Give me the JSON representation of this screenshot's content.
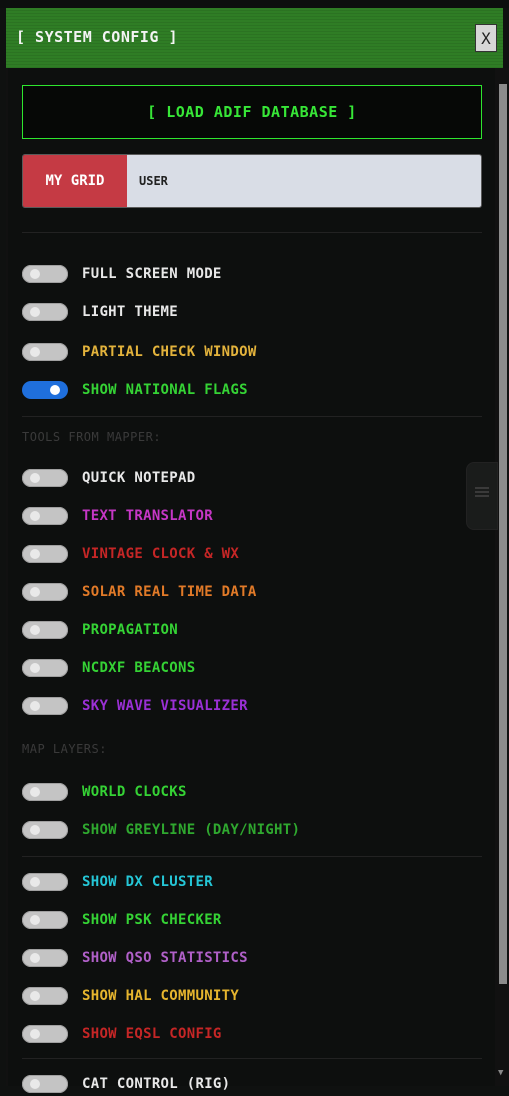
{
  "header": {
    "title": "[ SYSTEM CONFIG ]",
    "close_label": "X"
  },
  "load_button": {
    "label": "[ LOAD ADIF DATABASE ]"
  },
  "grid": {
    "label": "MY GRID",
    "value": "USER"
  },
  "sections": {
    "tools": "TOOLS FROM MAPPER:",
    "map_layers": "MAP LAYERS:"
  },
  "toggles": [
    {
      "label": "FULL SCREEN MODE",
      "on": false,
      "color": "#e8e8e8"
    },
    {
      "label": "LIGHT THEME",
      "on": false,
      "color": "#e8e8e8"
    },
    {
      "label": "PARTIAL CHECK WINDOW",
      "on": false,
      "color": "#e3b33c"
    },
    {
      "label": "SHOW NATIONAL FLAGS",
      "on": true,
      "color": "#35d335"
    },
    {
      "label": "QUICK NOTEPAD",
      "on": false,
      "color": "#e8e8e8"
    },
    {
      "label": "TEXT TRANSLATOR",
      "on": false,
      "color": "#c637c6"
    },
    {
      "label": "VINTAGE CLOCK & WX",
      "on": false,
      "color": "#c52626"
    },
    {
      "label": "SOLAR REAL TIME DATA",
      "on": false,
      "color": "#e17a28"
    },
    {
      "label": "PROPAGATION",
      "on": false,
      "color": "#35d335"
    },
    {
      "label": "NCDXF BEACONS",
      "on": false,
      "color": "#35d335"
    },
    {
      "label": "SKY WAVE VISUALIZER",
      "on": false,
      "color": "#9b30d6"
    },
    {
      "label": "WORLD CLOCKS",
      "on": false,
      "color": "#35d335"
    },
    {
      "label": "SHOW GREYLINE (DAY/NIGHT)",
      "on": false,
      "color": "#2fa82f"
    },
    {
      "label": "SHOW DX CLUSTER",
      "on": false,
      "color": "#25c6d6"
    },
    {
      "label": "SHOW PSK CHECKER",
      "on": false,
      "color": "#35d335"
    },
    {
      "label": "SHOW QSO STATISTICS",
      "on": false,
      "color": "#b060c8"
    },
    {
      "label": "SHOW HAL COMMUNITY",
      "on": false,
      "color": "#e6b52e"
    },
    {
      "label": "SHOW EQSL CONFIG",
      "on": false,
      "color": "#c52626"
    },
    {
      "label": "CAT CONTROL (RIG)",
      "on": false,
      "color": "#e8e8e8"
    }
  ]
}
